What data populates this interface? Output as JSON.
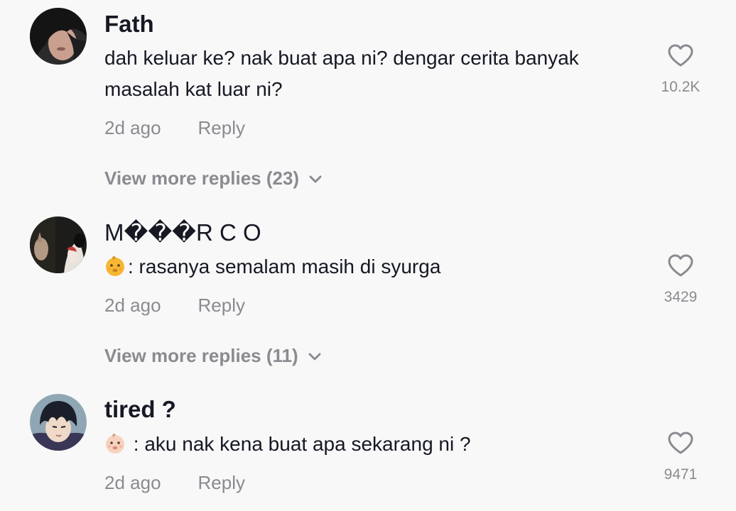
{
  "comments": [
    {
      "username": "Fath",
      "text": "dah keluar ke? nak buat apa ni? dengar cerita banyak masalah kat luar ni?",
      "time": "2d ago",
      "reply_label": "Reply",
      "likes": "10.2K",
      "view_more": "View more replies (23)"
    },
    {
      "username": "M���R C O",
      "emoji": "baby-face-emoji",
      "text": ": rasanya semalam masih di syurga",
      "time": "2d ago",
      "reply_label": "Reply",
      "likes": "3429",
      "view_more": "View more replies (11)"
    },
    {
      "username": "tired ?",
      "emoji": "baby-face-emoji",
      "text": " : aku nak kena buat apa sekarang ni ?",
      "time": "2d ago",
      "reply_label": "Reply",
      "likes": "9471"
    }
  ],
  "colors": {
    "background": "#f8f8f8",
    "text_primary": "#161823",
    "text_secondary": "#8a8b91"
  }
}
